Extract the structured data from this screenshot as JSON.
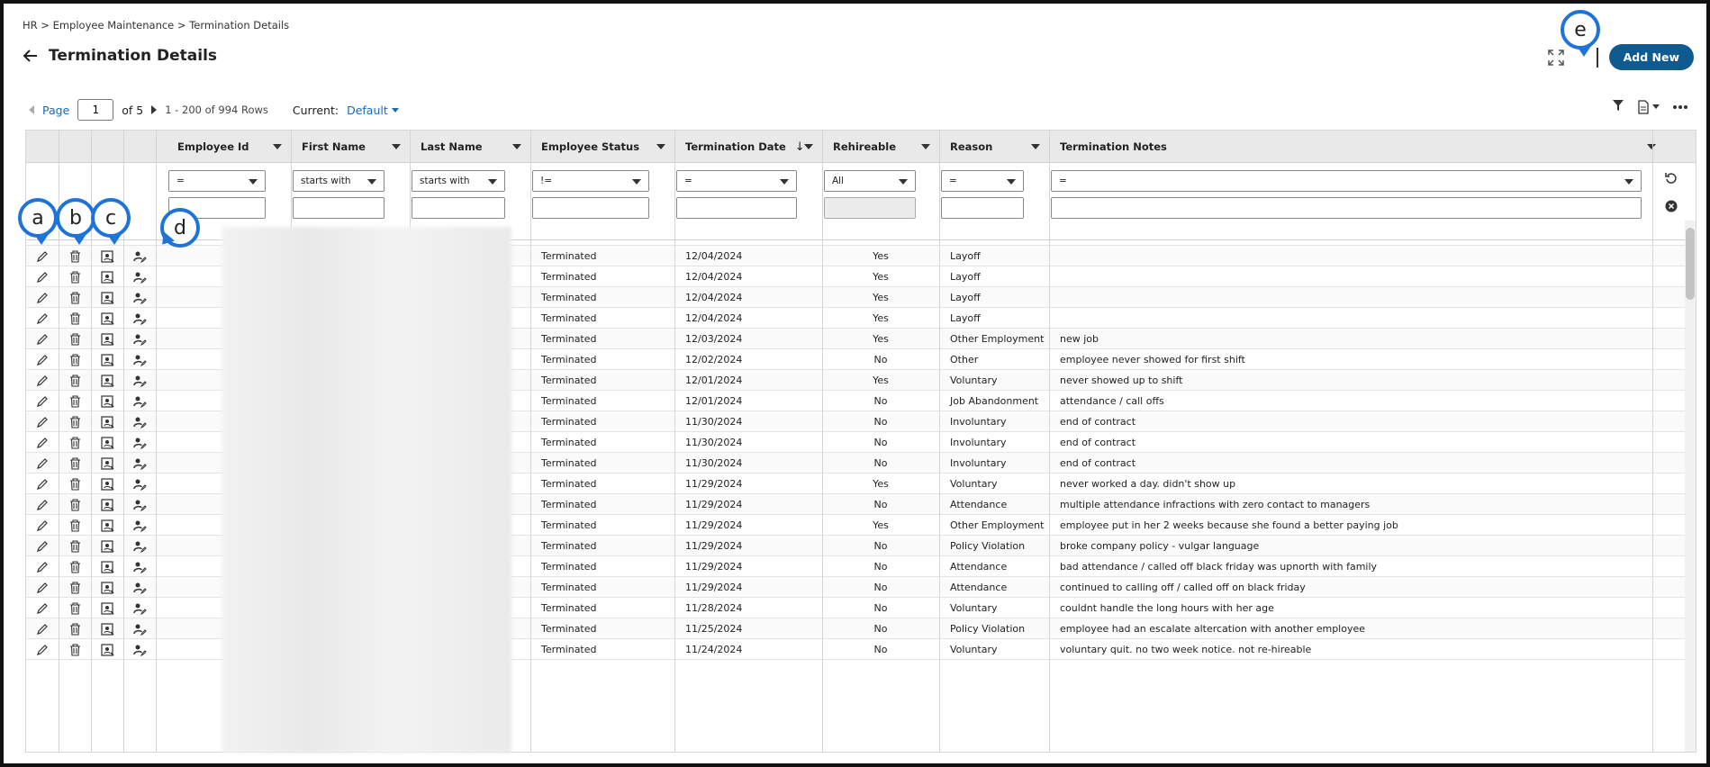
{
  "breadcrumb": "HR > Employee Maintenance > Termination Details",
  "page_title": "Termination Details",
  "actions": {
    "add_new": "Add New"
  },
  "pager": {
    "page_label": "Page",
    "page_value": "1",
    "of_label": "of 5",
    "rows_info": "1 - 200 of 994 Rows",
    "current_label": "Current:",
    "current_value": "Default"
  },
  "columns": [
    "Employee Id",
    "First Name",
    "Last Name",
    "Employee Status",
    "Termination Date",
    "Rehireable",
    "Reason",
    "Termination Notes"
  ],
  "sort_indicator": "↓",
  "filters": {
    "employee_id": "=",
    "first_name": "starts with",
    "last_name": "starts with",
    "employee_status": "!=",
    "termination_date": "=",
    "rehireable": "All",
    "reason": "=",
    "termination_notes": "="
  },
  "rows": [
    {
      "status": "Terminated",
      "date": "12/04/2024",
      "rehire": "Yes",
      "reason": "Layoff",
      "notes": ""
    },
    {
      "status": "Terminated",
      "date": "12/04/2024",
      "rehire": "Yes",
      "reason": "Layoff",
      "notes": ""
    },
    {
      "status": "Terminated",
      "date": "12/04/2024",
      "rehire": "Yes",
      "reason": "Layoff",
      "notes": ""
    },
    {
      "status": "Terminated",
      "date": "12/04/2024",
      "rehire": "Yes",
      "reason": "Layoff",
      "notes": ""
    },
    {
      "status": "Terminated",
      "date": "12/03/2024",
      "rehire": "Yes",
      "reason": "Other Employment",
      "notes": "new job"
    },
    {
      "status": "Terminated",
      "date": "12/02/2024",
      "rehire": "No",
      "reason": "Other",
      "notes": "employee never showed for first shift"
    },
    {
      "status": "Terminated",
      "date": "12/01/2024",
      "rehire": "Yes",
      "reason": "Voluntary",
      "notes": "never showed up to shift"
    },
    {
      "status": "Terminated",
      "date": "12/01/2024",
      "rehire": "No",
      "reason": "Job Abandonment",
      "notes": "attendance / call offs"
    },
    {
      "status": "Terminated",
      "date": "11/30/2024",
      "rehire": "No",
      "reason": "Involuntary",
      "notes": "end of contract"
    },
    {
      "status": "Terminated",
      "date": "11/30/2024",
      "rehire": "No",
      "reason": "Involuntary",
      "notes": "end of contract"
    },
    {
      "status": "Terminated",
      "date": "11/30/2024",
      "rehire": "No",
      "reason": "Involuntary",
      "notes": "end of contract"
    },
    {
      "status": "Terminated",
      "date": "11/29/2024",
      "rehire": "Yes",
      "reason": "Voluntary",
      "notes": "never worked a day. didn't show up"
    },
    {
      "status": "Terminated",
      "date": "11/29/2024",
      "rehire": "No",
      "reason": "Attendance",
      "notes": "multiple attendance infractions with zero contact to managers"
    },
    {
      "status": "Terminated",
      "date": "11/29/2024",
      "rehire": "Yes",
      "reason": "Other Employment",
      "notes": "employee put in her 2 weeks because she found a better paying job"
    },
    {
      "status": "Terminated",
      "date": "11/29/2024",
      "rehire": "No",
      "reason": "Policy Violation",
      "notes": "broke company policy - vulgar language"
    },
    {
      "status": "Terminated",
      "date": "11/29/2024",
      "rehire": "No",
      "reason": "Attendance",
      "notes": "bad attendance / called off black friday was upnorth with family"
    },
    {
      "status": "Terminated",
      "date": "11/29/2024",
      "rehire": "No",
      "reason": "Attendance",
      "notes": "continued to calling off / called off on black friday"
    },
    {
      "status": "Terminated",
      "date": "11/28/2024",
      "rehire": "No",
      "reason": "Voluntary",
      "notes": "couldnt handle the long hours with her age"
    },
    {
      "status": "Terminated",
      "date": "11/25/2024",
      "rehire": "No",
      "reason": "Policy Violation",
      "notes": "employee had an escalate altercation with another employee"
    },
    {
      "status": "Terminated",
      "date": "11/24/2024",
      "rehire": "No",
      "reason": "Voluntary",
      "notes": "voluntary quit. no two week notice. not re-hireable"
    }
  ],
  "callouts": {
    "a": "a",
    "b": "b",
    "c": "c",
    "d": "d",
    "e": "e"
  },
  "colors": {
    "accent": "#0f5b8f",
    "link": "#1769b0",
    "callout": "#1e73d8"
  }
}
